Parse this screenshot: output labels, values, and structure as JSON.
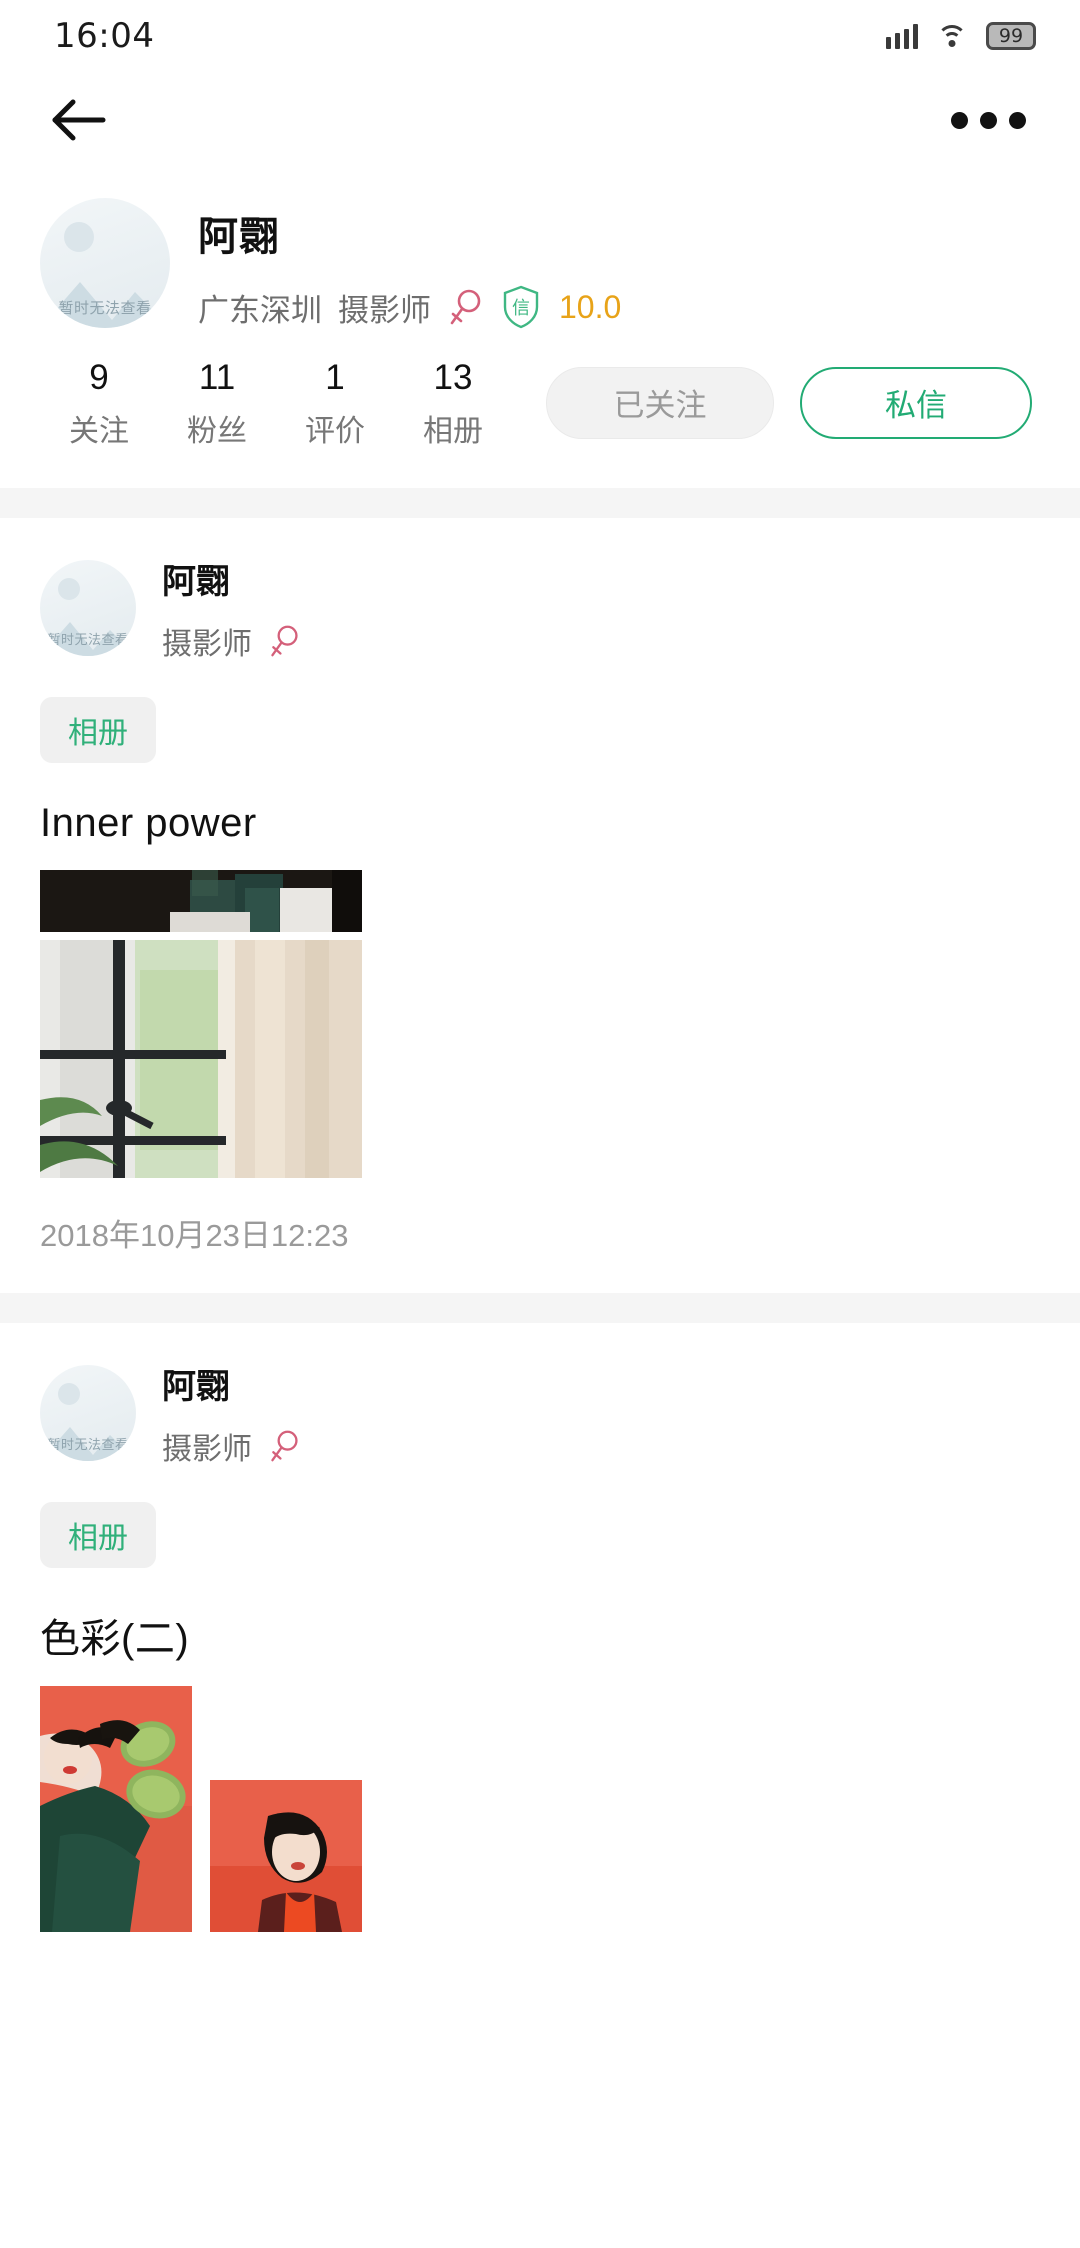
{
  "status_bar": {
    "time": "16:04",
    "battery_level": "99",
    "signal_icon": "signal-bars-icon",
    "wifi_icon": "wifi-icon",
    "battery_icon": "battery-icon"
  },
  "nav_bar": {
    "back_icon": "back-arrow-icon",
    "more_icon": "more-options-icon"
  },
  "profile": {
    "avatar_placeholder_text": "暂时无法查看",
    "name": "阿翾",
    "location": "广东深圳",
    "occupation": "摄影师",
    "gender_icon": "female-gender-icon",
    "cert_badge_icon": "credit-shield-icon",
    "cert_badge_text": "信",
    "score": "10.0",
    "score_color": "#e8a318",
    "accent_color": "#22ab74",
    "stats": [
      {
        "value": "9",
        "label": "关注"
      },
      {
        "value": "11",
        "label": "粉丝"
      },
      {
        "value": "1",
        "label": "评价"
      },
      {
        "value": "13",
        "label": "相册"
      }
    ],
    "follow_button": "已关注",
    "message_button": "私信"
  },
  "posts": [
    {
      "avatar_placeholder_text": "暂时无法查看",
      "name": "阿翾",
      "occupation": "摄影师",
      "gender_icon": "female-gender-icon",
      "tag": "相册",
      "title": "Inner power",
      "time": "2018年10月23日12:23"
    },
    {
      "avatar_placeholder_text": "暂时无法查看",
      "name": "阿翾",
      "occupation": "摄影师",
      "gender_icon": "female-gender-icon",
      "tag": "相册",
      "title": "色彩(二)",
      "time": ""
    }
  ]
}
